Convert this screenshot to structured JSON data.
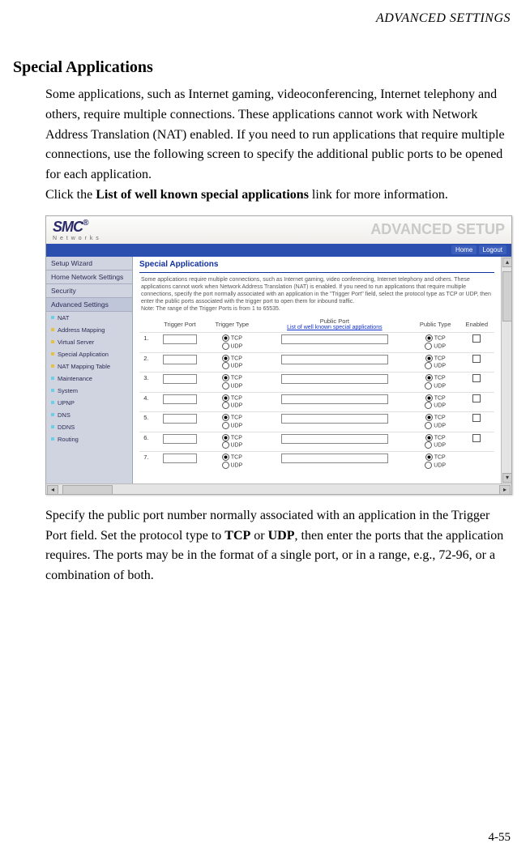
{
  "header_label": "ADVANCED SETTINGS",
  "heading": "Special Applications",
  "para1": "Some applications, such as Internet gaming, videoconferencing, Internet telephony and others, require multiple connections. These applications cannot work with Network Address Translation (NAT) enabled. If you need to run applications that require multiple connections, use the following screen to specify the additional public ports to be opened for each application.",
  "para2_a": "Click the ",
  "para2_bold": "List of well known special applications",
  "para2_b": " link for more information.",
  "para3_a": "Specify the public port number normally associated with an application in the Trigger Port field. Set the protocol type to ",
  "para3_tcp": "TCP",
  "para3_mid": " or ",
  "para3_udp": "UDP",
  "para3_b": ", then enter the ports that the application requires. The ports may be in the format of a single port, or in a range, e.g., 72-96, or a combination of both.",
  "page_number": "4-55",
  "screenshot": {
    "logo_text": "SMC",
    "logo_reg": "®",
    "logo_sub": "N e t w o r k s",
    "adv_setup": "ADVANCED SETUP",
    "home": "Home",
    "logout": "Logout",
    "sidebar": [
      "Setup Wizard",
      "Home Network Settings",
      "Security",
      "Advanced Settings"
    ],
    "sidebar_sub": [
      "NAT",
      "Address Mapping",
      "Virtual Server",
      "Special Application",
      "NAT Mapping Table",
      "Maintenance",
      "System",
      "UPNP",
      "DNS",
      "DDNS",
      "Routing"
    ],
    "panel_title": "Special Applications",
    "panel_desc": "Some applications require multiple connections, such as Internet gaming, video conferencing, Internet telephony and others. These applications cannot work when Network Address Translation (NAT) is enabled. If you need to run applications that require multiple connections, specify the port normally associated with an application in the \"Trigger Port\" field, select the protocol type as TCP or UDP, then enter the public ports associated with the trigger port to open them for inbound traffic.",
    "panel_note": "Note: The range of the Trigger Ports is from 1 to 65535.",
    "headers": {
      "trigger_port": "Trigger Port",
      "trigger_type": "Trigger Type",
      "public_port": "Public Port",
      "public_type": "Public Type",
      "enabled": "Enabled"
    },
    "link_text": "List of well known special applications",
    "tcp": "TCP",
    "udp": "UDP",
    "rows": [
      "1.",
      "2.",
      "3.",
      "4.",
      "5.",
      "6.",
      "7."
    ]
  }
}
